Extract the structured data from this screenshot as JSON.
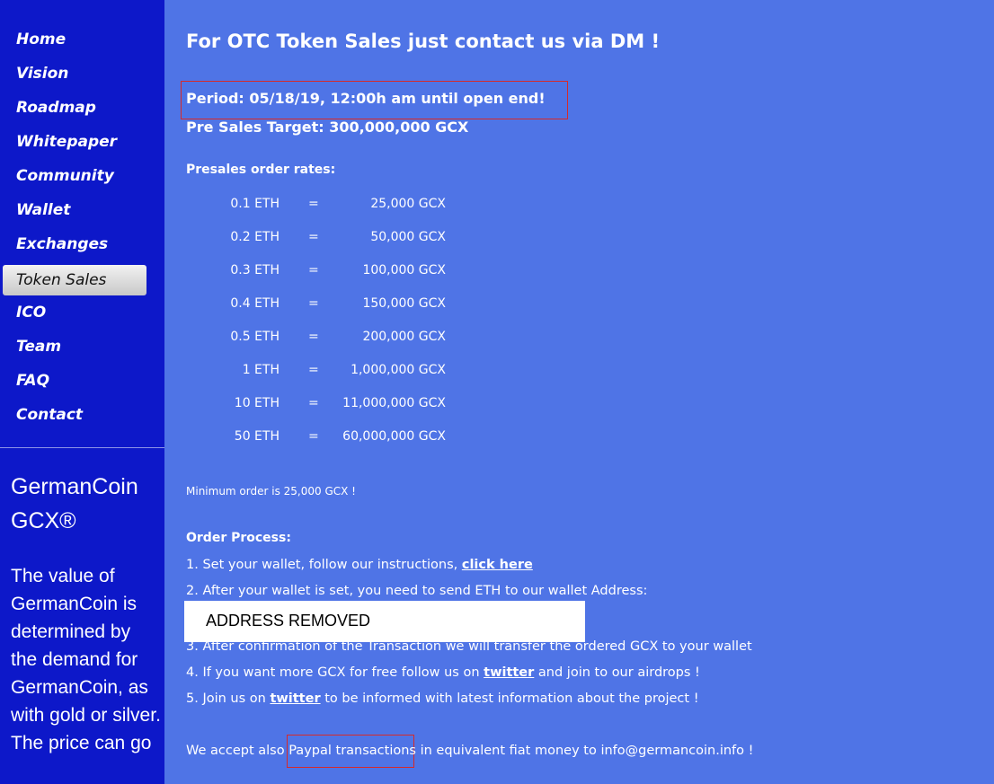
{
  "sidebar": {
    "nav": [
      {
        "label": "Home"
      },
      {
        "label": "Vision"
      },
      {
        "label": "Roadmap"
      },
      {
        "label": "Whitepaper"
      },
      {
        "label": "Community"
      },
      {
        "label": "Wallet"
      },
      {
        "label": "Exchanges"
      },
      {
        "label": "Token Sales",
        "active": true
      },
      {
        "label": "ICO"
      },
      {
        "label": "Team"
      },
      {
        "label": "FAQ"
      },
      {
        "label": "Contact"
      }
    ],
    "brand": "GermanCoin GCX®",
    "description": "The value of GermanCoin is determined by the demand for GermanCoin, as with gold or silver. The price can go"
  },
  "main": {
    "heading": "For OTC Token Sales just contact us via DM !",
    "period": "Period: 05/18/19, 12:00h am until open end!",
    "target": "Pre Sales Target: 300,000,000 GCX",
    "rates_title": "Presales order rates:",
    "rates": [
      {
        "eth": "0.1 ETH",
        "eq": "=",
        "gcx": "25,000 GCX"
      },
      {
        "eth": "0.2 ETH",
        "eq": "=",
        "gcx": "50,000 GCX"
      },
      {
        "eth": "0.3 ETH",
        "eq": "=",
        "gcx": "100,000 GCX"
      },
      {
        "eth": "0.4 ETH",
        "eq": "=",
        "gcx": "150,000 GCX"
      },
      {
        "eth": "0.5 ETH",
        "eq": "=",
        "gcx": "200,000 GCX"
      },
      {
        "eth": "1 ETH",
        "eq": "=",
        "gcx": "1,000,000 GCX"
      },
      {
        "eth": "10 ETH",
        "eq": "=",
        "gcx": "11,000,000 GCX"
      },
      {
        "eth": "50 ETH",
        "eq": "=",
        "gcx": "60,000,000 GCX"
      }
    ],
    "min_order": "Minimum order is 25,000 GCX !",
    "order_title": "Order Process:",
    "step1_text": "1. Set your wallet, follow our instructions, ",
    "step1_link": "click here",
    "step2_text": "2. After your wallet is set, you need to send ETH to our wallet Address:",
    "address_removed": "ADDRESS REMOVED",
    "step3_text": "3. After confirmation of the Transaction we will transfer the ordered GCX to your wallet",
    "step4_pre": "4. If you want more GCX for free follow us on ",
    "step4_link": "twitter",
    "step4_post": " and join to our airdrops !",
    "step5_pre": "5. Join us on ",
    "step5_link": "twitter",
    "step5_post": " to be informed with latest information about the project !",
    "paypal_pre": "We accept also ",
    "paypal_highlight": "Paypal transactions",
    "paypal_post": " in equivalent fiat money to info@germancoin.info !"
  },
  "colors": {
    "sidebar_bg": "#0d18c9",
    "main_bg": "#4f74e6",
    "highlight_border": "#d62a2a"
  }
}
